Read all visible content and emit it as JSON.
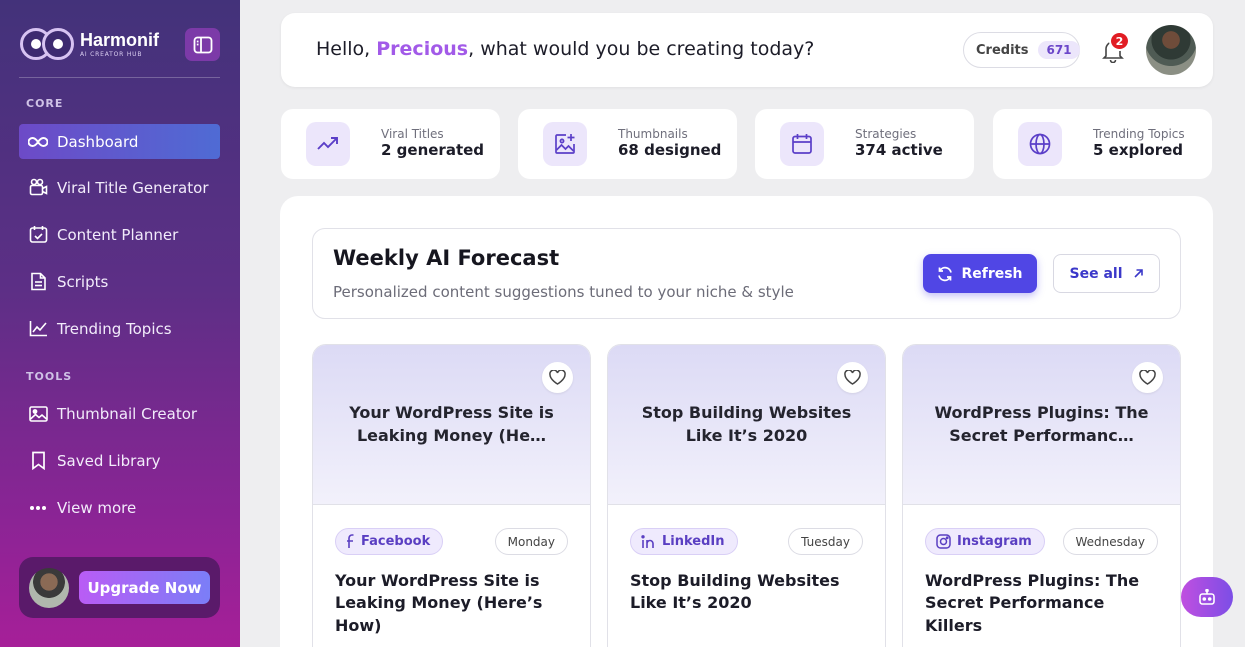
{
  "brand": {
    "name": "Harmonif",
    "tagline": "AI CREATOR HUB"
  },
  "sidebar": {
    "core_label": "CORE",
    "tools_label": "TOOLS",
    "items": [
      {
        "label": "Dashboard",
        "icon": "infinity-icon",
        "active": true
      },
      {
        "label": "Viral Title Generator",
        "icon": "video-icon"
      },
      {
        "label": "Content Planner",
        "icon": "calendar-check-icon"
      },
      {
        "label": "Scripts",
        "icon": "document-icon"
      },
      {
        "label": "Trending Topics",
        "icon": "line-chart-icon"
      },
      {
        "label": "Thumbnail Creator",
        "icon": "image-icon"
      },
      {
        "label": "Saved Library",
        "icon": "bookmark-icon"
      },
      {
        "label": "View more",
        "icon": "more-dots-icon"
      }
    ],
    "upgrade_label": "Upgrade Now"
  },
  "header": {
    "greeting_prefix": "Hello, ",
    "user_name": "Precious",
    "greeting_suffix": ", what would you be creating today?",
    "credits_label": "Credits",
    "credits_count": "671",
    "notification_count": "2"
  },
  "stats": [
    {
      "label": "Viral Titles",
      "value": "2 generated",
      "icon": "trend-up-icon"
    },
    {
      "label": "Thumbnails",
      "value": "68 designed",
      "icon": "image-plus-icon"
    },
    {
      "label": "Strategies",
      "value": "374 active",
      "icon": "calendar-icon"
    },
    {
      "label": "Trending Topics",
      "value": "5 explored",
      "icon": "globe-icon"
    }
  ],
  "forecast": {
    "title": "Weekly AI Forecast",
    "subtitle": "Personalized content suggestions tuned to your niche & style",
    "refresh_label": "Refresh",
    "see_all_label": "See all"
  },
  "ideas": [
    {
      "preview": "Your WordPress Site is Leaking Money (He…",
      "platform": "Facebook",
      "platform_icon": "facebook-icon",
      "day": "Monday",
      "title": "Your WordPress Site is Leaking Money (Here’s How)"
    },
    {
      "preview": "Stop Building Websites Like It’s 2020",
      "platform": "LinkedIn",
      "platform_icon": "linkedin-icon",
      "day": "Tuesday",
      "title": "Stop Building Websites Like It’s 2020"
    },
    {
      "preview": "WordPress Plugins: The Secret Performanc…",
      "platform": "Instagram",
      "platform_icon": "instagram-icon",
      "day": "Wednesday",
      "title": "WordPress Plugins: The Secret Performance Killers"
    }
  ],
  "colors": {
    "accent": "#5046e5",
    "highlight": "#a25ae8",
    "badge": "#e11d24"
  }
}
